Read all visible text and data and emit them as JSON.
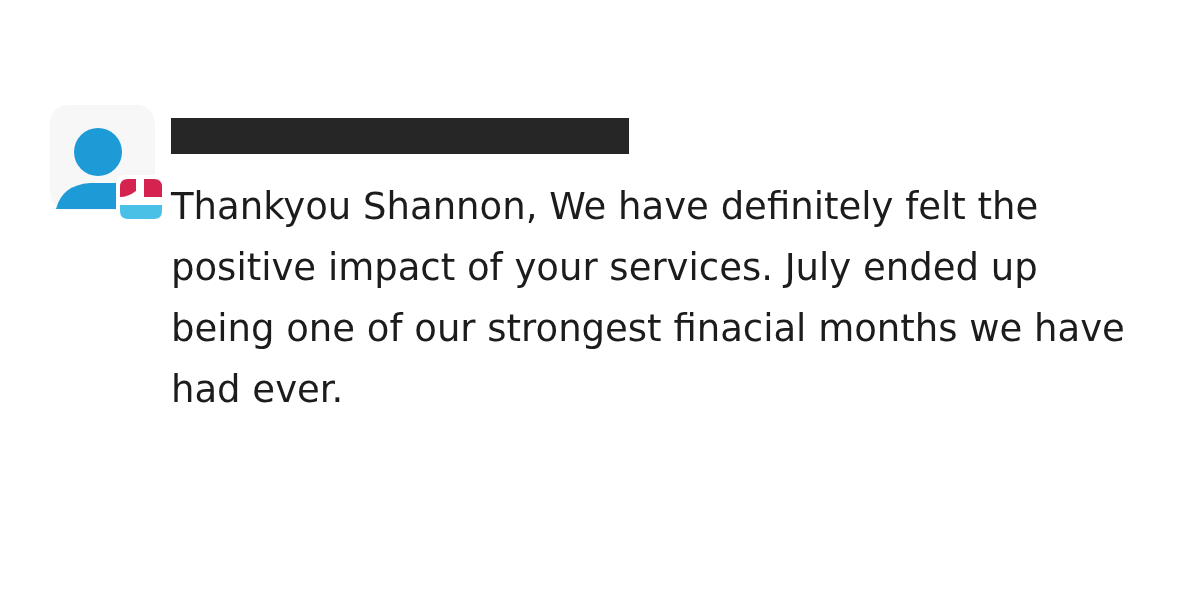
{
  "message": {
    "author_redacted": true,
    "text": "Thankyou Shannon, We have definitely felt the positive impact of your services. July ended up being one of our strongest finacial months we have had ever."
  }
}
